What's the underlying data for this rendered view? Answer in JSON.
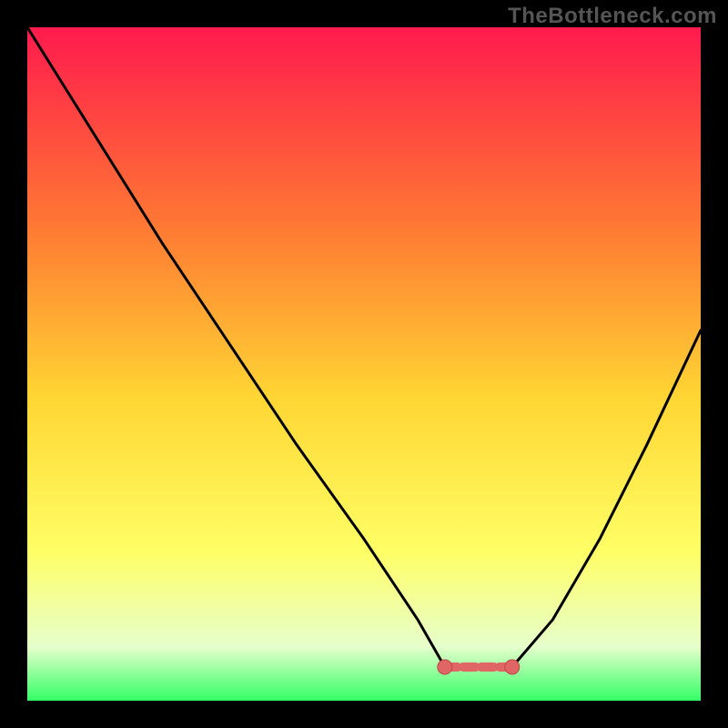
{
  "attribution": "TheBottleneck.com",
  "colors": {
    "page_bg": "#000000",
    "attribution_text": "#555555",
    "curve_stroke": "#000000",
    "marker_fill": "#e06666",
    "marker_stroke": "#c04545",
    "gradient_top": "#ff1a4d",
    "gradient_mid_upper": "#ff7a33",
    "gradient_mid": "#ffd633",
    "gradient_mid_lower": "#ffff66",
    "gradient_low": "#e6ffcc",
    "gradient_bottom": "#33ff66"
  },
  "chart_data": {
    "type": "line",
    "title": "",
    "xlabel": "",
    "ylabel": "",
    "xlim": [
      0,
      100
    ],
    "ylim": [
      0,
      100
    ],
    "grid": false,
    "legend": false,
    "note": "V-shaped curve over vertical red→yellow→green gradient; highlighted flat trough segment near x≈62–72, y≈5. Values estimated from pixels.",
    "series": [
      {
        "name": "curve",
        "x": [
          0,
          10,
          20,
          30,
          40,
          50,
          58,
          62,
          65,
          68,
          72,
          78,
          85,
          92,
          100
        ],
        "y": [
          100,
          84,
          68,
          53,
          38,
          24,
          12,
          5,
          5,
          5,
          5,
          12,
          24,
          38,
          55
        ]
      },
      {
        "name": "trough-highlight",
        "x": [
          62,
          64,
          66,
          68,
          70,
          72
        ],
        "y": [
          5,
          5,
          5,
          5,
          5,
          5
        ]
      }
    ]
  }
}
